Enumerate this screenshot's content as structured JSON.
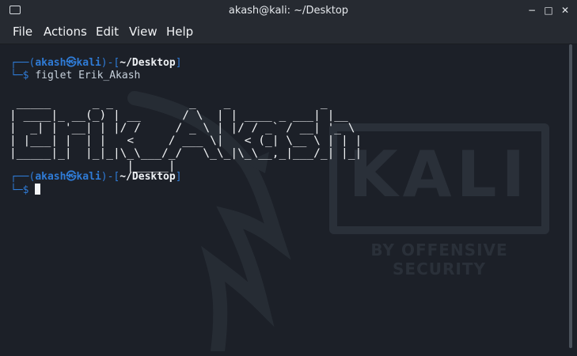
{
  "window": {
    "title": "akash@kali: ~/Desktop",
    "controls": [
      "−",
      "□",
      "✕"
    ]
  },
  "menu": [
    "File",
    "Actions",
    "Edit",
    "View",
    "Help"
  ],
  "terminal": {
    "prompt1": {
      "prefix": "┌──(",
      "user": "akash",
      "at": "㉿",
      "host": "kali",
      "mid": ")-[",
      "path": "~/Desktop",
      "end": "]",
      "line2": "└─$ ",
      "command": "figlet Erik_Akash"
    },
    "ascii_art": [
      " _____      _ _           _    _             _     ",
      "| ____|_ __(_) | __      / \\  | | ____ _ ___| |__  ",
      "|  _| | '__| | |/ /     / _ \\ | |/ / _` / __| '_ \\ ",
      "| |___| |  | |   <     / ___ \\|   < (_| \\__ \\ | | |",
      "|_____|_|  |_|_|\\_\\___/_/   \\_\\_|\\_\\__,_|___/_| |_|",
      "                 |_____|                            "
    ],
    "prompt2": {
      "prefix": "┌──(",
      "user": "akash",
      "at": "㉿",
      "host": "kali",
      "mid": ")-[",
      "path": "~/Desktop",
      "end": "]",
      "line2": "└─$ "
    }
  },
  "background": {
    "logo": "KALI",
    "tagline": "BY OFFENSIVE SECURITY"
  }
}
